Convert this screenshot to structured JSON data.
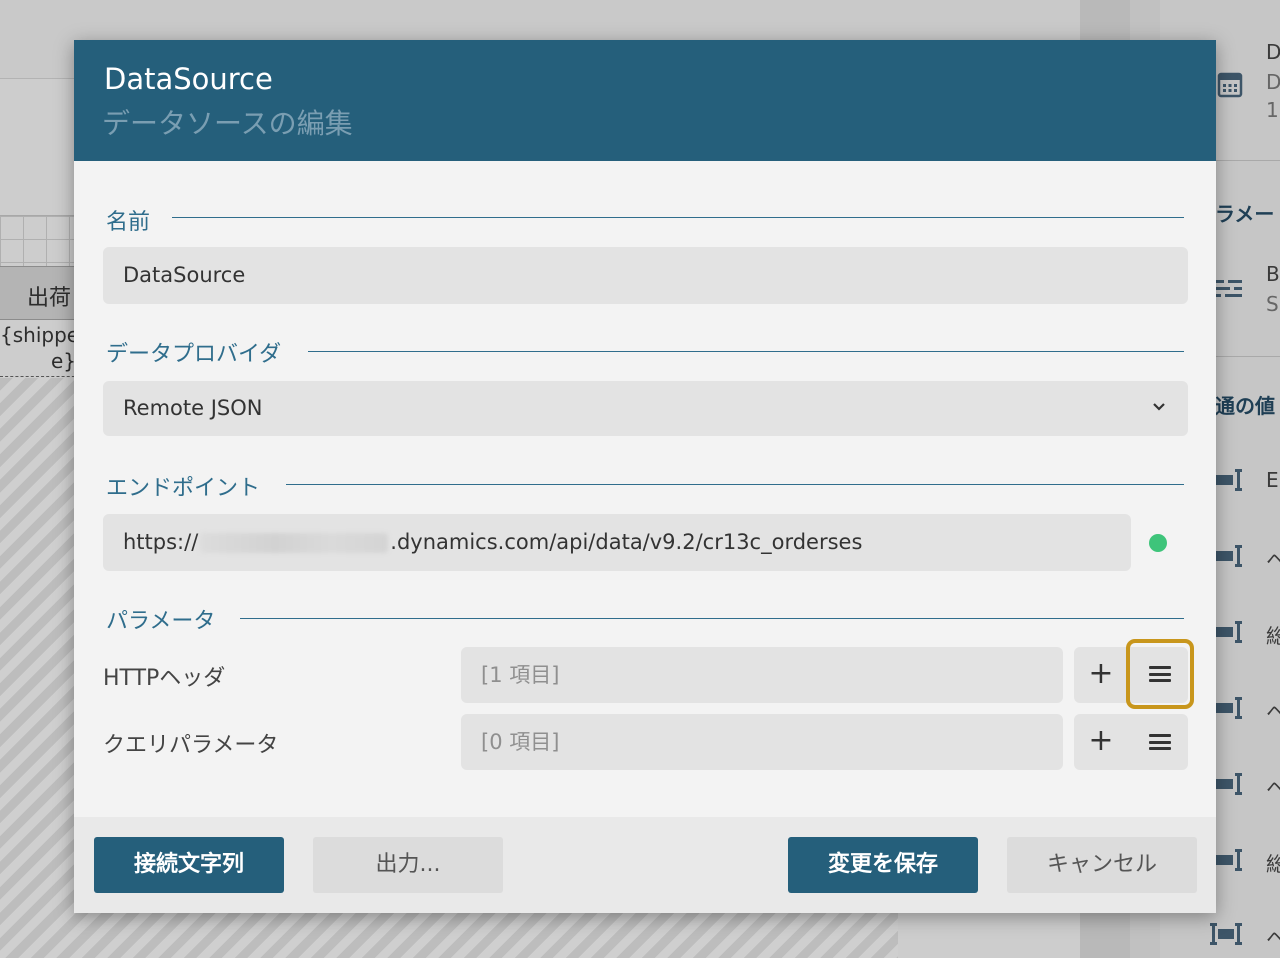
{
  "background": {
    "table_header": "出荷",
    "table_field": "{shippe e}",
    "right_panel": {
      "items": [
        {
          "label": "D"
        },
        {
          "label": "D"
        },
        {
          "label": "1"
        },
        {
          "label": "ラメー"
        },
        {
          "label": "B"
        },
        {
          "label": "S"
        },
        {
          "label": "通の値"
        },
        {
          "label": "E"
        },
        {
          "label": "ヘ"
        },
        {
          "label": "総"
        },
        {
          "label": "ヘ"
        },
        {
          "label": "ヘ"
        },
        {
          "label": "総"
        },
        {
          "label": "ヘ"
        }
      ]
    }
  },
  "dialog": {
    "title": "DataSource",
    "subtitle": "データソースの編集",
    "name_section": {
      "label": "名前",
      "value": "DataSource"
    },
    "provider_section": {
      "label": "データプロバイダ",
      "value": "Remote JSON"
    },
    "endpoint_section": {
      "label": "エンドポイント",
      "url_prefix": "https://",
      "url_suffix": ".dynamics.com/api/data/v9.2/cr13c_orderses",
      "status_color": "#3ec47a"
    },
    "parameters_section": {
      "label": "パラメータ",
      "rows": [
        {
          "label": "HTTPヘッダ",
          "value": "[1 項目]"
        },
        {
          "label": "クエリパラメータ",
          "value": "[0 項目]"
        }
      ],
      "add_glyph": "+"
    },
    "footer": {
      "connection_string": "接続文字列",
      "output": "出力...",
      "save_changes": "変更を保存",
      "cancel": "キャンセル"
    }
  },
  "colors": {
    "header_bg": "#255f7b",
    "accent": "#2f6d8c",
    "highlight": "#c8961c"
  }
}
